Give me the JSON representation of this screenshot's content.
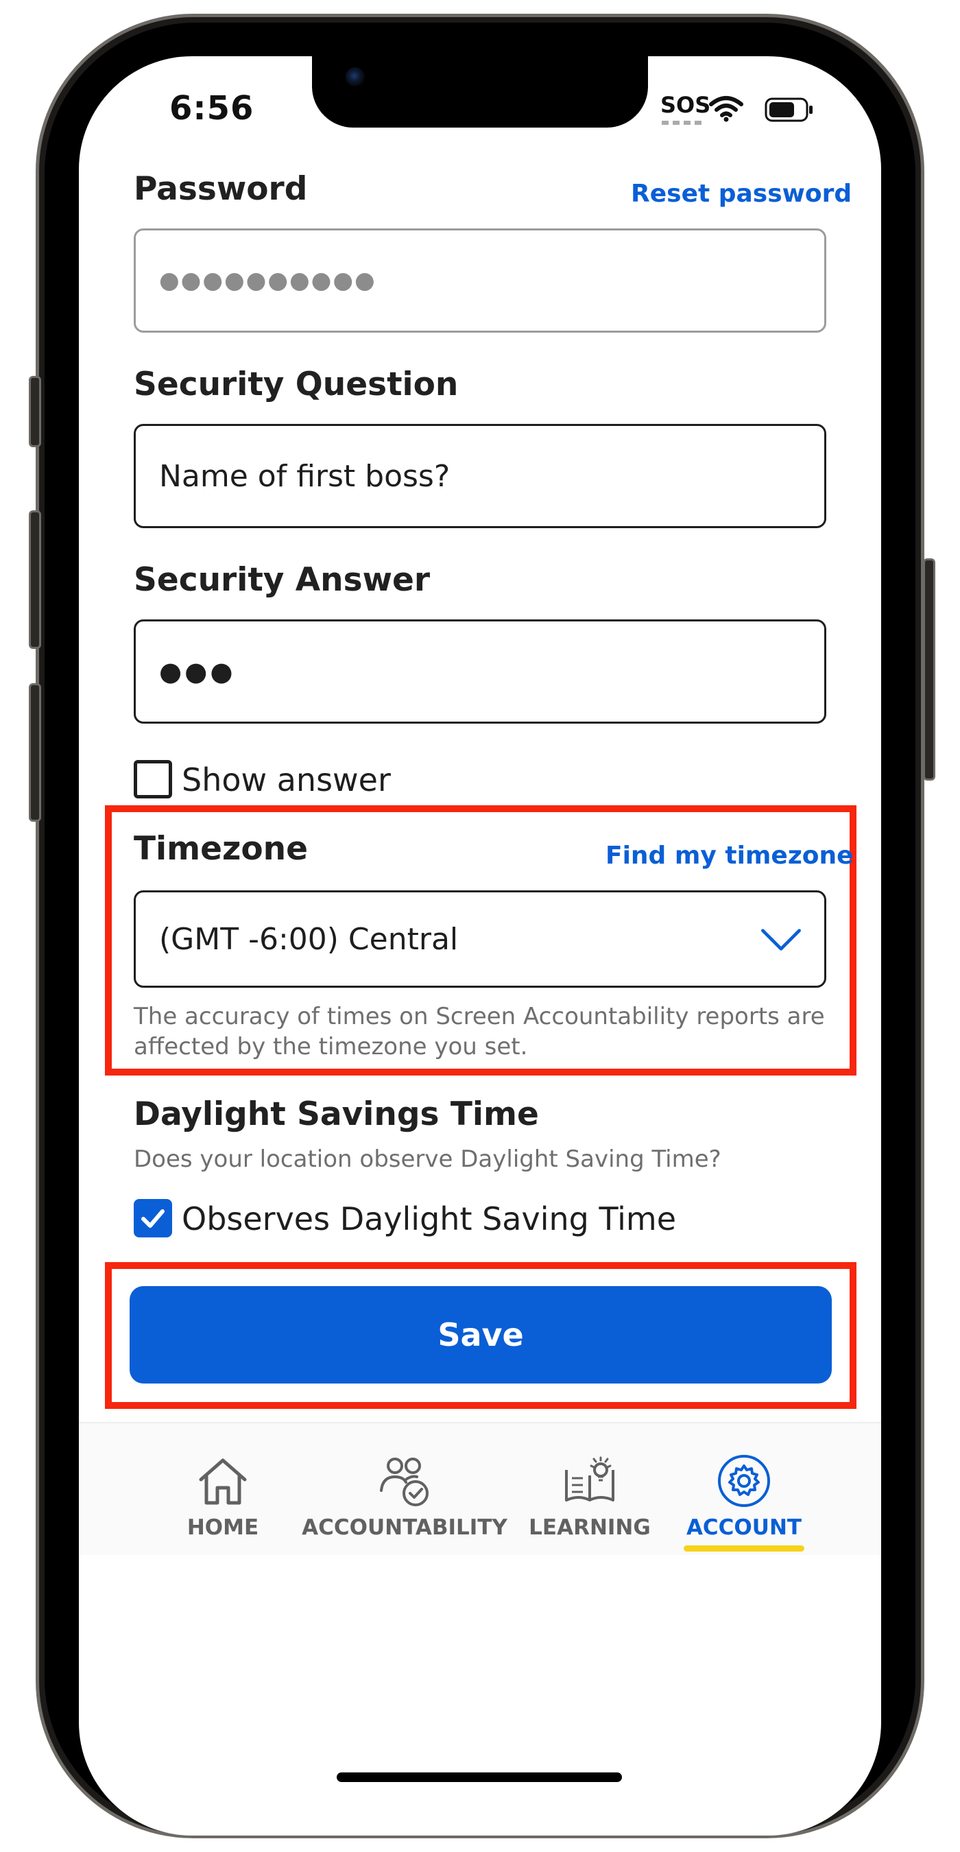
{
  "status_bar": {
    "time": "6:56",
    "carrier_text": "SOS"
  },
  "password": {
    "label": "Password",
    "reset_link": "Reset password",
    "value": "●●●●●●●●●●"
  },
  "security_question": {
    "label": "Security Question",
    "value": "Name of first boss?"
  },
  "security_answer": {
    "label": "Security Answer",
    "value": "●●●"
  },
  "show_answer": {
    "label": "Show answer",
    "checked": false
  },
  "timezone": {
    "label": "Timezone",
    "find_link": "Find my timezone",
    "selected": "(GMT -6:00) Central",
    "help_line1": "The accuracy of times on Screen Accountability reports are",
    "help_line2": "affected by the timezone you set."
  },
  "dst": {
    "title": "Daylight Savings Time",
    "question": "Does your location observe Daylight Saving Time?",
    "checkbox_label": "Observes Daylight Saving Time",
    "checked": true
  },
  "save_label": "Save",
  "tabs": [
    {
      "label": "HOME",
      "icon": "home-icon",
      "active": false
    },
    {
      "label": "ACCOUNTABILITY",
      "icon": "people-check-icon",
      "active": false
    },
    {
      "label": "LEARNING",
      "icon": "book-lightbulb-icon",
      "active": false
    },
    {
      "label": "ACCOUNT",
      "icon": "gear-icon",
      "active": true
    }
  ],
  "colors": {
    "accent": "#0a5fd6",
    "highlight": "#f7260e",
    "tab_underline": "#f7d21a"
  }
}
